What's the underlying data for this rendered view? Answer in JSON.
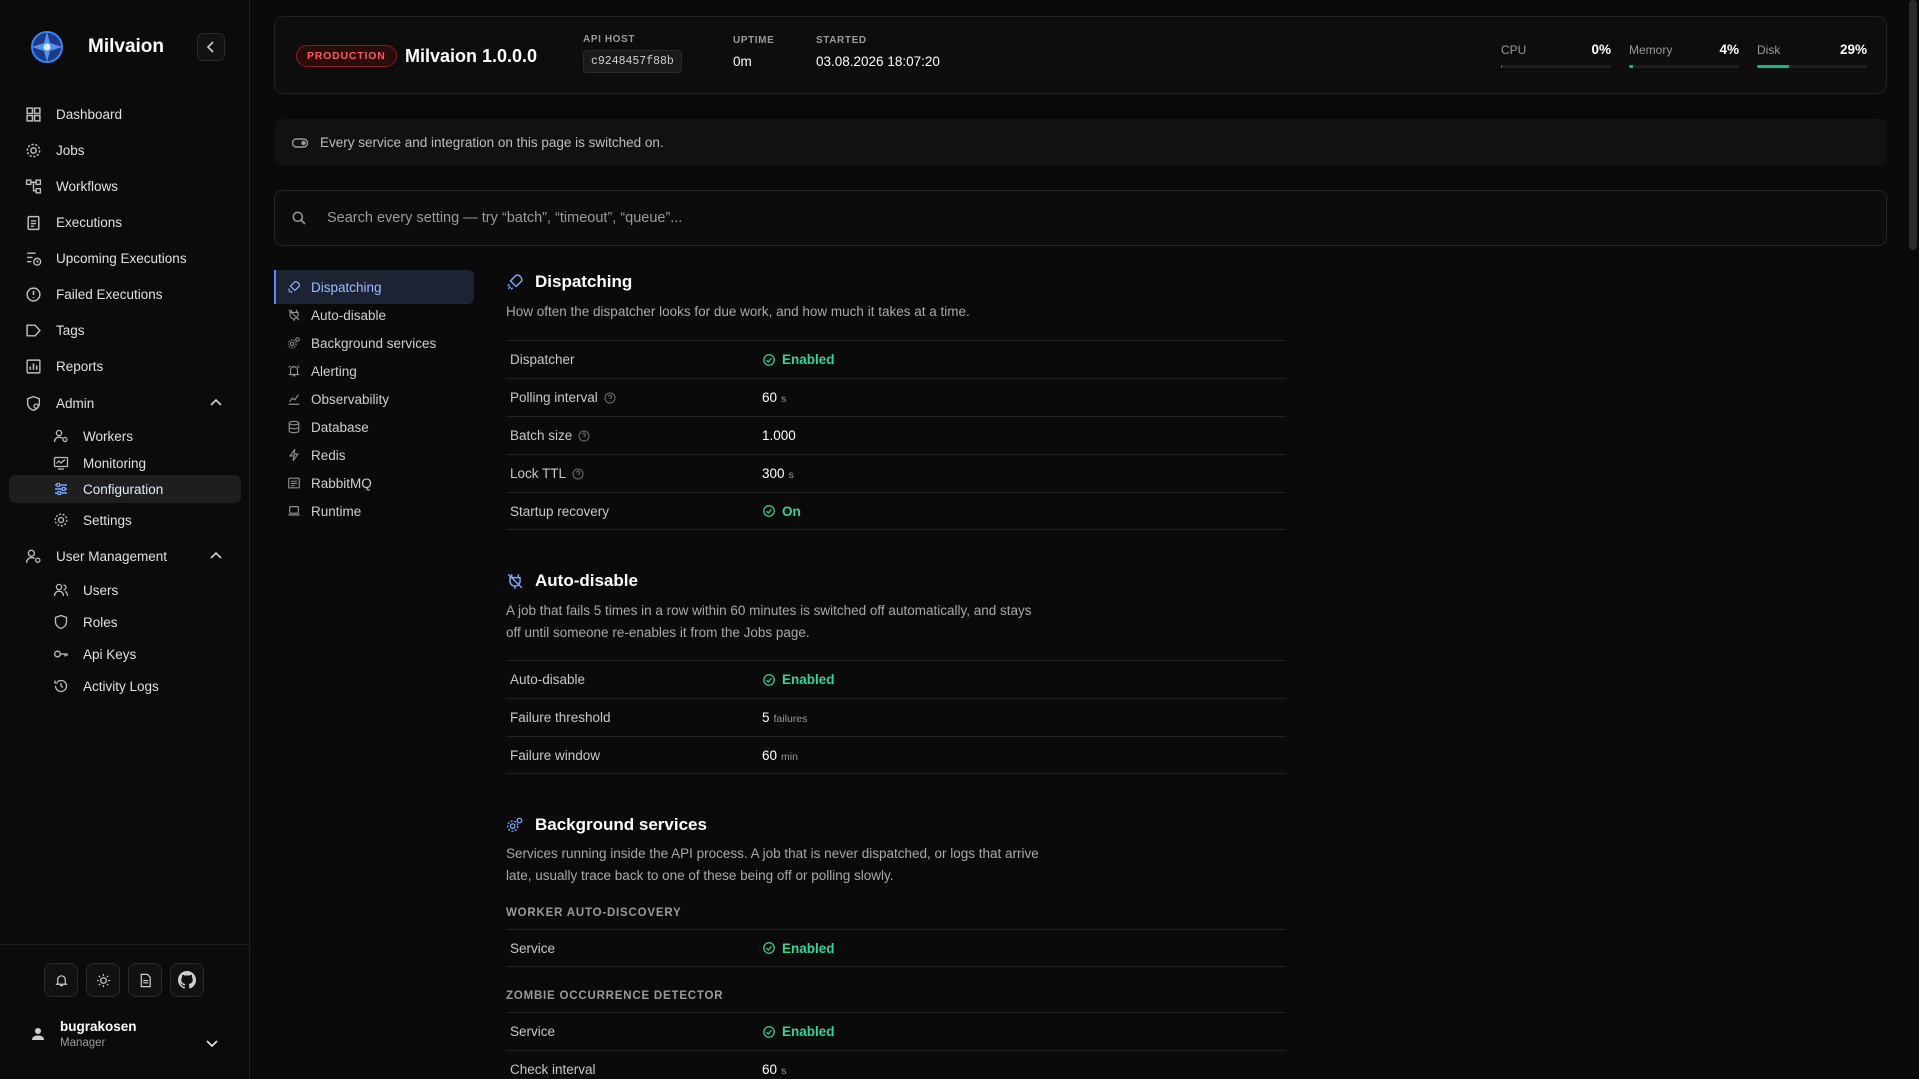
{
  "brand": {
    "name": "Milvaion"
  },
  "sidebar": {
    "items": [
      {
        "label": "Dashboard"
      },
      {
        "label": "Jobs"
      },
      {
        "label": "Workflows"
      },
      {
        "label": "Executions"
      },
      {
        "label": "Upcoming Executions"
      },
      {
        "label": "Failed Executions"
      },
      {
        "label": "Tags"
      },
      {
        "label": "Reports"
      }
    ],
    "admin": {
      "label": "Admin",
      "children": [
        {
          "label": "Workers"
        },
        {
          "label": "Monitoring"
        },
        {
          "label": "Configuration"
        },
        {
          "label": "Settings"
        }
      ]
    },
    "user_management": {
      "label": "User Management",
      "children": [
        {
          "label": "Users"
        },
        {
          "label": "Roles"
        },
        {
          "label": "Api Keys"
        },
        {
          "label": "Activity Logs"
        }
      ]
    },
    "user": {
      "name": "bugrakosen",
      "role": "Manager"
    }
  },
  "header": {
    "env_badge": "PRODUCTION",
    "app_version": "Milvaion 1.0.0.0",
    "api_host_label": "API HOST",
    "api_host_value": "c9248457f88b",
    "uptime_label": "UPTIME",
    "uptime_value": "0m",
    "started_label": "STARTED",
    "started_value": "03.08.2026 18:07:20",
    "metrics": [
      {
        "label": "CPU",
        "value": "0%",
        "fraction": 0.01
      },
      {
        "label": "Memory",
        "value": "4%",
        "fraction": 0.04
      },
      {
        "label": "Disk",
        "value": "29%",
        "fraction": 0.29
      }
    ]
  },
  "notice": "Every service and integration on this page is switched on.",
  "search": {
    "placeholder": "Search every setting — try “batch”, “timeout”, “queue”..."
  },
  "section_nav": [
    {
      "label": "Dispatching"
    },
    {
      "label": "Auto-disable"
    },
    {
      "label": "Background services"
    },
    {
      "label": "Alerting"
    },
    {
      "label": "Observability"
    },
    {
      "label": "Database"
    },
    {
      "label": "Redis"
    },
    {
      "label": "RabbitMQ"
    },
    {
      "label": "Runtime"
    }
  ],
  "dispatching": {
    "title": "Dispatching",
    "desc": "How often the dispatcher looks for due work, and how much it takes at a time.",
    "rows": [
      {
        "label": "Dispatcher",
        "value": "Enabled"
      },
      {
        "label": "Polling interval",
        "value": "60",
        "unit": "s"
      },
      {
        "label": "Batch size",
        "value": "1.000"
      },
      {
        "label": "Lock TTL",
        "value": "300",
        "unit": "s"
      },
      {
        "label": "Startup recovery",
        "value": "On"
      }
    ]
  },
  "auto_disable": {
    "title": "Auto-disable",
    "desc": "A job that fails 5 times in a row within 60 minutes is switched off automatically, and stays off until someone re-enables it from the Jobs page.",
    "rows": [
      {
        "label": "Auto-disable",
        "value": "Enabled"
      },
      {
        "label": "Failure threshold",
        "value": "5",
        "unit": "failures"
      },
      {
        "label": "Failure window",
        "value": "60",
        "unit": "min"
      }
    ]
  },
  "background": {
    "title": "Background services",
    "desc": "Services running inside the API process. A job that is never dispatched, or logs that arrive late, usually trace back to one of these being off or polling slowly.",
    "worker_auto_discovery": {
      "label": "WORKER AUTO-DISCOVERY",
      "row_label": "Service",
      "row_value": "Enabled"
    },
    "zombie_detector": {
      "label": "ZOMBIE OCCURRENCE DETECTOR",
      "rows": [
        {
          "label": "Service",
          "value": "Enabled"
        },
        {
          "label": "Check interval",
          "value": "60",
          "unit": "s"
        }
      ]
    }
  }
}
